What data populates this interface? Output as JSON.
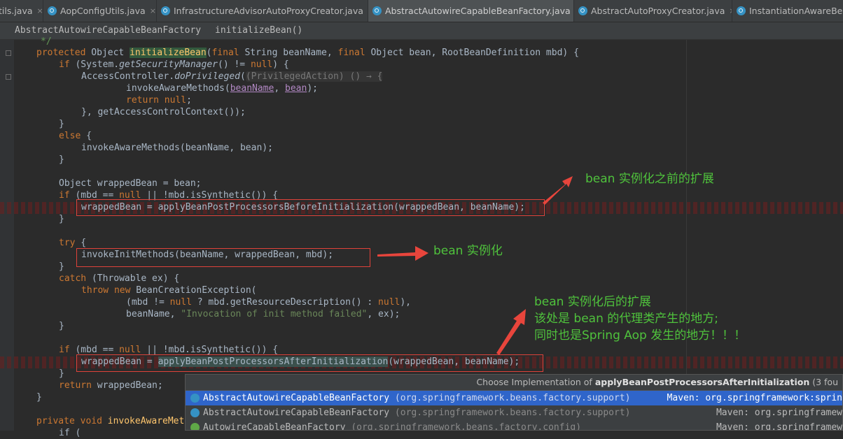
{
  "tabs": [
    {
      "label": "tils.java",
      "close": "×"
    },
    {
      "label": "AopConfigUtils.java",
      "close": "×"
    },
    {
      "label": "InfrastructureAdvisorAutoProxyCreator.java",
      "close": "×"
    },
    {
      "label": "AbstractAutowireCapableBeanFactory.java",
      "close": "×"
    },
    {
      "label": "AbstractAutoProxyCreator.java",
      "close": "×"
    },
    {
      "label": "InstantiationAwareBea"
    }
  ],
  "breadcrumb": {
    "class_name": "AbstractAutowireCapableBeanFactory",
    "method": "initializeBean()"
  },
  "code": {
    "l0": "*/",
    "l1": {
      "kw1": "protected",
      "t1": " Object ",
      "name": "initializeBean",
      "t2": "(",
      "kw2": "final",
      "t3": " String beanName, ",
      "kw3": "final",
      "t4": " Object bean, RootBeanDefinition mbd) {"
    },
    "l2": {
      "kw1": "if",
      "t1": " (System.",
      "call": "getSecurityManager",
      "t2": "() != ",
      "kw2": "null",
      "t3": ") {"
    },
    "l3": {
      "t1": "AccessController.",
      "call": "doPrivileged",
      "t2": "(",
      "hint": "(PrivilegedAction) () → {"
    },
    "l4": {
      "t1": "invokeAwareMethods(",
      "p1": "beanName",
      "t2": ", ",
      "p2": "bean",
      "t3": ");"
    },
    "l5": {
      "kw": "return null",
      "t1": ";"
    },
    "l6": {
      "t1": "}, getAccessControlContext());"
    },
    "l7": "}",
    "l8": {
      "kw": "else",
      "t1": " {"
    },
    "l9": "invokeAwareMethods(beanName, bean);",
    "l10": "}",
    "l11": "Object wrappedBean = bean;",
    "l12": {
      "kw1": "if",
      "t1": " (mbd == ",
      "kw2": "null",
      "t2": " || !mbd.isSynthetic()) {"
    },
    "l13": "wrappedBean = applyBeanPostProcessorsBeforeInitialization(wrappedBean, beanName);",
    "l14": "}",
    "l15": {
      "kw": "try",
      "t1": " {"
    },
    "l16": "invokeInitMethods(beanName, wrappedBean, mbd);",
    "l17": "}",
    "l18": {
      "kw": "catch",
      "t1": " (Throwable ex) {"
    },
    "l19": {
      "kw1": "throw",
      "t1": " ",
      "kw2": "new",
      "t2": " BeanCreationException("
    },
    "l20": {
      "t1": "(mbd != ",
      "kw1": "null",
      "t2": " ? mbd.getResourceDescription() : ",
      "kw2": "null",
      "t3": "),"
    },
    "l21": {
      "t1": "beanName, ",
      "str": "\"Invocation of init method failed\"",
      "t2": ", ex);"
    },
    "l22": "}",
    "l23": {
      "kw1": "if",
      "t1": " (mbd == ",
      "kw2": "null",
      "t2": " || !mbd.isSynthetic()) {"
    },
    "l24": {
      "t1": "wrappedBean = ",
      "hl": "applyBeanPostProcessorsAfterInitialization",
      "t2": "(wrappedBean, beanName);"
    },
    "l25": "}",
    "l26": {
      "kw": "return",
      "t1": " wrappedBean;"
    },
    "l27": "}",
    "l28": {
      "kw": "private void",
      "t1": " ",
      "name": "invokeAwareMet"
    },
    "l29": "if ("
  },
  "annotations": {
    "before": "bean 实例化之前的扩展",
    "init": "bean 实例化",
    "after1": "bean 实例化后的扩展",
    "after2": "该处是 bean 的代理类产生的地方;",
    "after3": "同时也是Spring Aop 发生的地方！！！"
  },
  "popup": {
    "title_prefix": "Choose Implementation of ",
    "title_method": "applyBeanPostProcessorsAfterInitialization",
    "title_suffix": " (3 fou",
    "rows": [
      {
        "name": "AbstractAutowireCapableBeanFactory",
        "pkg": " (org.springframework.beans.factory.support)",
        "maven": "Maven: org.springframework:sprin"
      },
      {
        "name": "AbstractAutowireCapableBeanFactory",
        "pkg": " (org.springframework.beans.factory.support)",
        "maven": "Maven: org.springframew"
      },
      {
        "name": "AutowireCapableBeanFactory",
        "pkg": " (org.springframework.beans.factory.config)",
        "maven": "Maven: org.springframew"
      }
    ]
  },
  "colors": {
    "background": "#2b2b2b",
    "keyword": "#cc7832",
    "method": "#ffc66d",
    "annotation": "#4fc23c",
    "box": "#e0423a",
    "selection": "#2f65ca"
  }
}
